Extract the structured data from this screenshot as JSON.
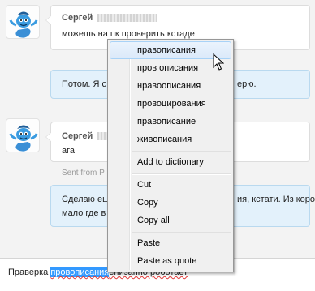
{
  "messages": [
    {
      "sender": "Сергей",
      "text": "можешь на пк проверить кстаде",
      "avatar_icon": "genie-avatar-icon"
    },
    {
      "text": "Потом. Я с",
      "text_tail": "ерю."
    },
    {
      "sender": "Сергей",
      "text": "ага",
      "avatar_icon": "genie-avatar-icon",
      "meta": "Sent from P"
    },
    {
      "text_line1": "Сделаю ещ",
      "text_line1_tail": "ия, кстати. Из коро",
      "text_line2": "мало где в",
      "text_line2_tail": ""
    }
  ],
  "input": {
    "before": "Праверка ",
    "selected": "провописания",
    "after": "енизапно роботает"
  },
  "context_menu": {
    "suggestions": [
      "правописания",
      "пров описания",
      "нравоописания",
      "провоцирования",
      "правописание",
      "живописания"
    ],
    "add_to_dictionary": "Add to dictionary",
    "edit": [
      "Cut",
      "Copy",
      "Copy all"
    ],
    "paste": [
      "Paste",
      "Paste as quote"
    ]
  }
}
